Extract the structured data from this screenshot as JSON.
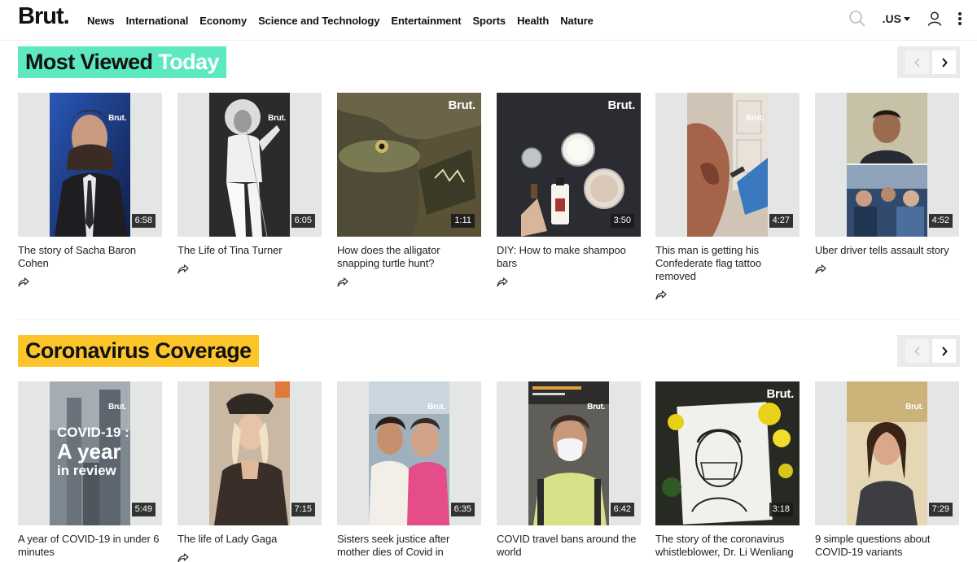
{
  "header": {
    "logo": "Brut.",
    "nav": [
      "News",
      "International",
      "Economy",
      "Science and Technology",
      "Entertainment",
      "Sports",
      "Health",
      "Nature"
    ],
    "region": ".US"
  },
  "sections": [
    {
      "title_part1": "Most Viewed",
      "title_part2": "Today",
      "title_color": "#5ce8c0",
      "videos": [
        {
          "title": "The story of Sacha Baron Cohen",
          "duration": "6:58",
          "brut": "Brut."
        },
        {
          "title": "The Life of Tina Turner",
          "duration": "6:05",
          "brut": "Brut."
        },
        {
          "title": "How does the alligator snapping turtle hunt?",
          "duration": "1:11",
          "brut": "Brut."
        },
        {
          "title": "DIY: How to make shampoo bars",
          "duration": "3:50",
          "brut": "Brut."
        },
        {
          "title": "This man is getting his Confederate flag tattoo removed",
          "duration": "4:27",
          "brut": "Brut."
        },
        {
          "title": "Uber driver tells assault story",
          "duration": "4:52",
          "brut": ""
        }
      ]
    },
    {
      "title_part1": "Coronavirus Coverage",
      "title_color": "#fcc52a",
      "videos": [
        {
          "title": "A year of COVID-19 in under 6 minutes",
          "duration": "5:49",
          "brut": "Brut.",
          "overlay": [
            "COVID-19 :",
            "A year",
            "in review"
          ]
        },
        {
          "title": "The life of Lady Gaga",
          "duration": "7:15",
          "brut": ""
        },
        {
          "title": "Sisters seek justice after mother dies of Covid in",
          "duration": "6:35",
          "brut": "Brut."
        },
        {
          "title": "COVID travel bans around the world",
          "duration": "6:42",
          "brut": "Brut."
        },
        {
          "title": "The story of the coronavirus whistleblower, Dr. Li Wenliang",
          "duration": "3:18",
          "brut": "Brut."
        },
        {
          "title": "9 simple questions about COVID-19 variants",
          "duration": "7:29",
          "brut": "Brut."
        }
      ]
    }
  ]
}
